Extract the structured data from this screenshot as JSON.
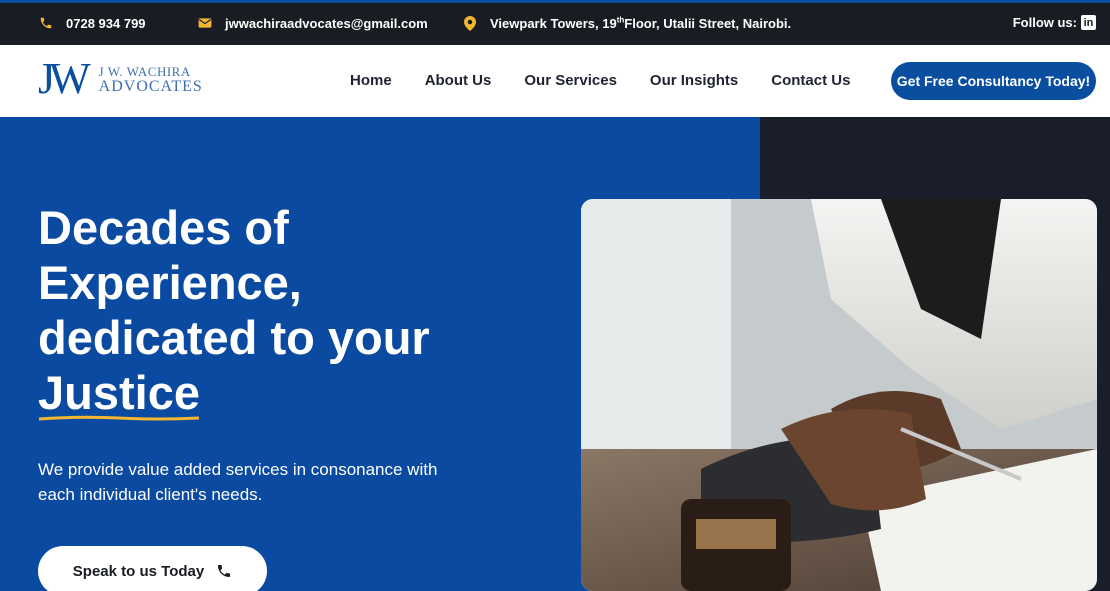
{
  "topbar": {
    "phone": "0728 934 799",
    "email": "jwwachiraadvocates@gmail.com",
    "address_pre": "Viewpark Towers, 19",
    "address_sup": "th",
    "address_post": "Floor, Utalii Street, Nairobi.",
    "follow_label": "Follow us:",
    "linkedin_glyph": "in"
  },
  "logo": {
    "mark": "JW",
    "line1": "J W. WACHIRA",
    "line2": "ADVOCATES"
  },
  "nav": {
    "items": [
      "Home",
      "About Us",
      "Our Services",
      "Our Insights",
      "Contact Us"
    ]
  },
  "cta": {
    "label": "Get Free Consultancy Today!"
  },
  "hero": {
    "line1": "Decades of",
    "line2": "Experience,",
    "line3": "dedicated to your",
    "highlight": "Justice",
    "subtitle": "We provide value added services in consonance with each individual client's needs.",
    "button_label": "Speak to us Today"
  },
  "colors": {
    "brand_blue": "#0a4ea0",
    "topbar_bg": "#1a1c23",
    "accent_yellow": "#f2b632"
  },
  "icons": {
    "phone": "phone-icon",
    "email": "email-icon",
    "location": "location-pin-icon",
    "linkedin": "linkedin-icon"
  }
}
